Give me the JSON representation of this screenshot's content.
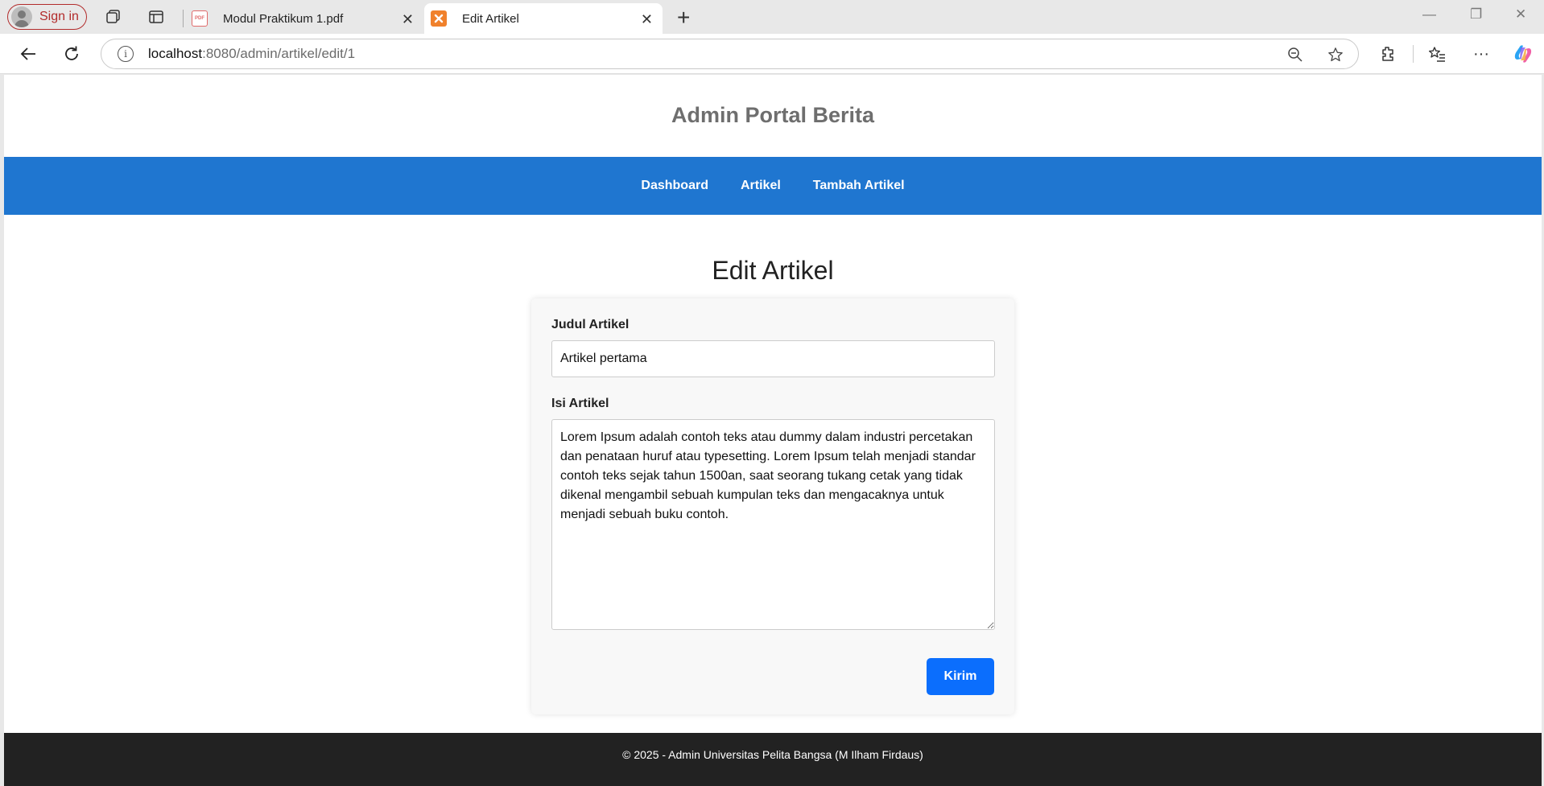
{
  "browser": {
    "signin_label": "Sign in",
    "tabs": [
      {
        "title": "Modul Praktikum 1.pdf",
        "favicon": "pdf-icon"
      },
      {
        "title": "Edit Artikel",
        "favicon": "xampp-icon"
      }
    ],
    "url_host": "localhost",
    "url_rest": ":8080/admin/artikel/edit/1"
  },
  "site": {
    "title": "Admin Portal Berita",
    "nav": [
      "Dashboard",
      "Artikel",
      "Tambah Artikel"
    ],
    "accent_color": "#1f76d0"
  },
  "form": {
    "heading": "Edit Artikel",
    "title_label": "Judul Artikel",
    "title_value": "Artikel pertama",
    "body_label": "Isi Artikel",
    "body_value": "Lorem Ipsum adalah contoh teks atau dummy dalam industri percetakan dan penataan huruf atau typesetting. Lorem Ipsum telah menjadi standar contoh teks sejak tahun 1500an, saat seorang tukang cetak yang tidak dikenal mengambil sebuah kumpulan teks dan mengacaknya untuk menjadi sebuah buku contoh.",
    "submit_label": "Kirim",
    "submit_color": "#0b6efd"
  },
  "footer": {
    "text": "© 2025 - Admin Universitas Pelita Bangsa (M Ilham Firdaus)"
  }
}
